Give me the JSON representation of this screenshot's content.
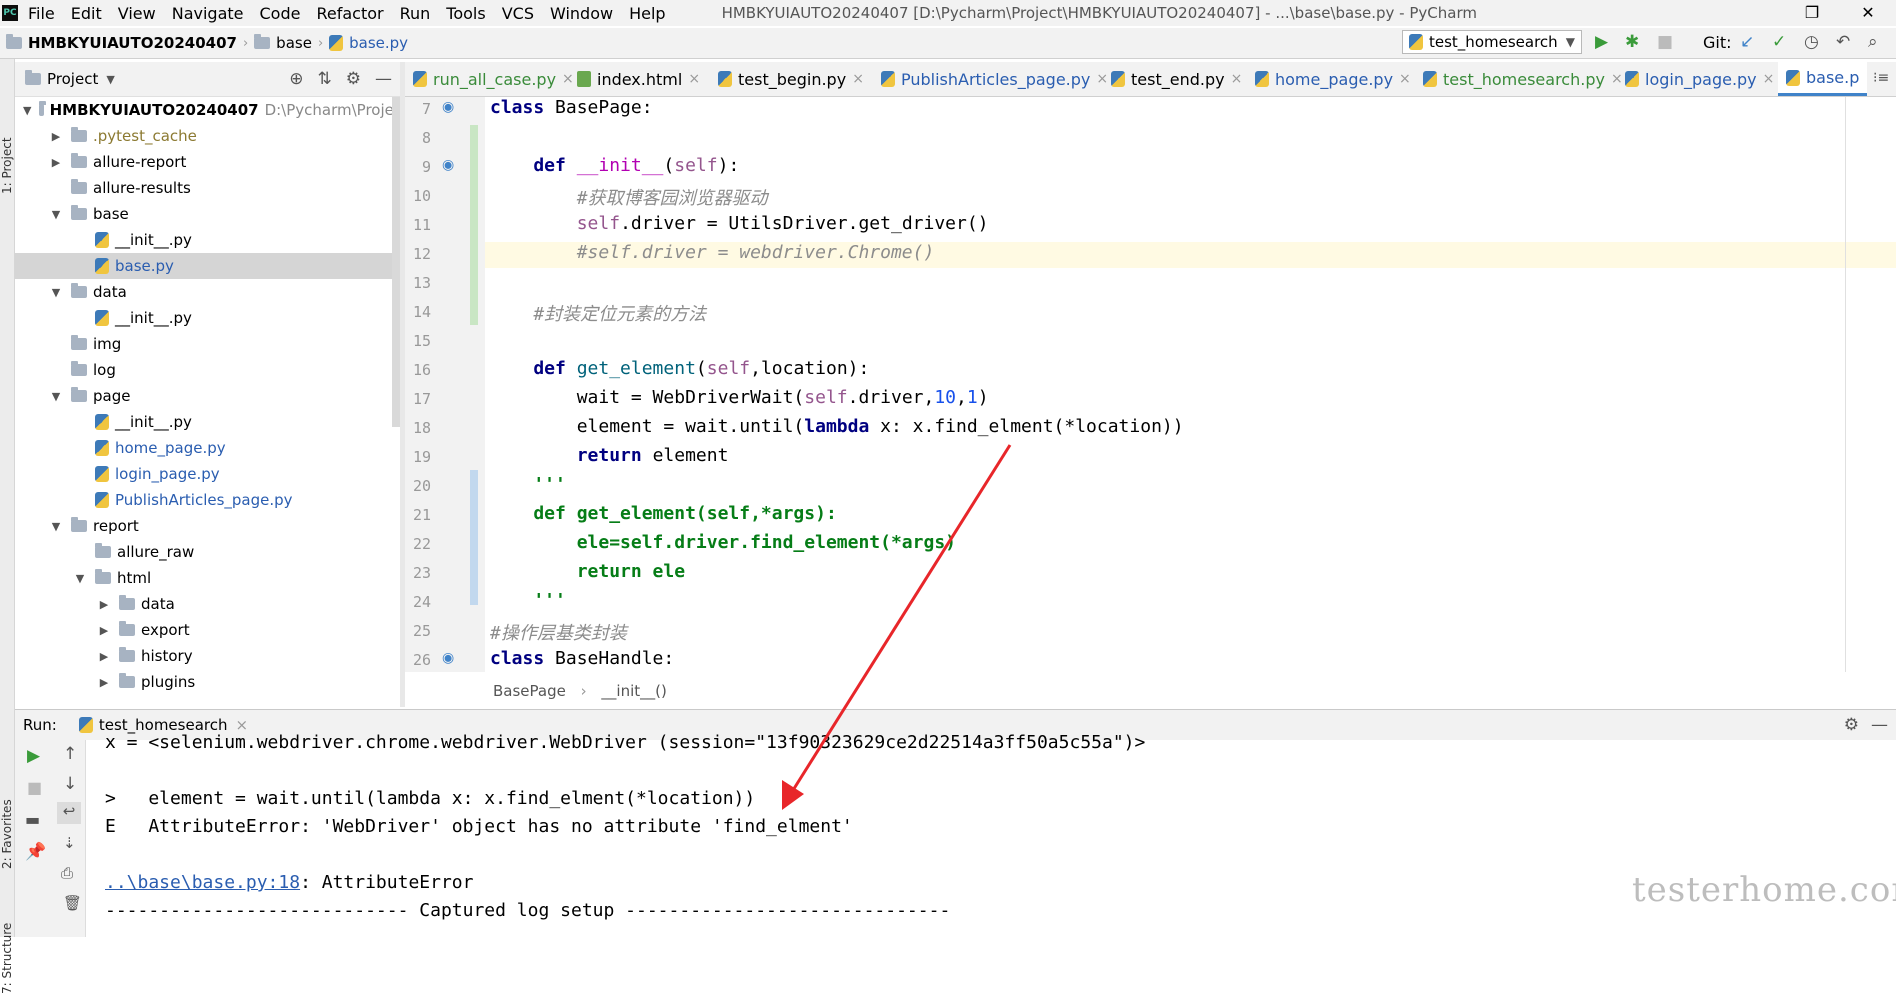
{
  "menu": [
    "File",
    "Edit",
    "View",
    "Navigate",
    "Code",
    "Refactor",
    "Run",
    "Tools",
    "VCS",
    "Window",
    "Help"
  ],
  "window_title": "HMBKYUIAUTO20240407 [D:\\Pycharm\\Project\\HMBKYUIAUTO20240407] - ...\\base\\base.py - PyCharm",
  "breadcrumb": [
    "HMBKYUIAUTO20240407",
    "base",
    "base.py"
  ],
  "run_config": "test_homesearch",
  "git_label": "Git:",
  "left_strip": {
    "project": "1: Project",
    "favorites": "2: Favorites",
    "structure": "7: Structure"
  },
  "project_panel": {
    "title": "Project",
    "root_name": "HMBKYUIAUTO20240407",
    "root_path": "D:\\Pycharm\\Project",
    "items": [
      {
        "label": ".pytest_cache"
      },
      {
        "label": "allure-report"
      },
      {
        "label": "allure-results"
      },
      {
        "label": "base"
      },
      {
        "label": "__init__.py"
      },
      {
        "label": "base.py"
      },
      {
        "label": "data"
      },
      {
        "label": "__init__.py"
      },
      {
        "label": "img"
      },
      {
        "label": "log"
      },
      {
        "label": "page"
      },
      {
        "label": "__init__.py"
      },
      {
        "label": "home_page.py"
      },
      {
        "label": "login_page.py"
      },
      {
        "label": "PublishArticles_page.py"
      },
      {
        "label": "report"
      },
      {
        "label": "allure_raw"
      },
      {
        "label": "html"
      },
      {
        "label": "data"
      },
      {
        "label": "export"
      },
      {
        "label": "history"
      },
      {
        "label": "plugins"
      }
    ]
  },
  "tabs": [
    "run_all_case.py",
    "index.html",
    "test_begin.py",
    "PublishArticles_page.py",
    "test_end.py",
    "home_page.py",
    "test_homesearch.py",
    "login_page.py",
    "base.p"
  ],
  "line_numbers": [
    "7",
    "8",
    "9",
    "10",
    "11",
    "12",
    "13",
    "14",
    "15",
    "16",
    "17",
    "18",
    "19",
    "20",
    "21",
    "22",
    "23",
    "24",
    "25",
    "26"
  ],
  "code": {
    "l7a": "class",
    "l7b": " BasePage:",
    "l9a": "    def ",
    "l9b": "__init__",
    "l9c": "(",
    "l9d": "self",
    "l9e": "):",
    "l10": "        #获取博客园浏览器驱动",
    "l11a": "        ",
    "l11b": "self",
    "l11c": ".driver = UtilsDriver.get_driver()",
    "l12": "        #self.driver = webdriver.Chrome()",
    "l14": "    #封装定位元素的方法",
    "l16a": "    def ",
    "l16b": "get_element",
    "l16c": "(",
    "l16d": "self",
    "l16e": ",location):",
    "l17a": "        wait = WebDriverWait(",
    "l17b": "self",
    "l17c": ".driver,",
    "l17d": "10",
    "l17e": ",",
    "l17f": "1",
    "l17g": ")",
    "l18a": "        element = wait.until(",
    "l18b": "lambda",
    "l18c": " x: x.find_elment(*location))",
    "l19a": "        ",
    "l19b": "return",
    "l19c": " element",
    "l20": "    '''",
    "l21": "    def get_element(self,*args):",
    "l22": "        ele=self.driver.find_element(*args)",
    "l23": "        return ele",
    "l24": "    '''",
    "l25": "#操作层基类封装",
    "l26a": "class",
    "l26b": " BaseHandle:"
  },
  "editor_breadcrumb": [
    "BasePage",
    "__init__()"
  ],
  "run_panel": {
    "label": "Run:",
    "tab": "test_homesearch",
    "lines": {
      "o1": "x = <selenium.webdriver.chrome.webdriver.WebDriver (session=\"13f90323629ce2d22514a3ff50a5c55a\")>",
      "o2": ">   element = wait.until(lambda x: x.find_elment(*location))",
      "o3": "E   AttributeError: 'WebDriver' object has no attribute 'find_elment'",
      "o4link": "..\\base\\base.py:18",
      "o4rest": ": AttributeError",
      "o5": "---------------------------- Captured log setup ------------------------------"
    }
  },
  "watermark": "testerhome.com",
  "colors": {
    "accent": "#4083c9",
    "arrow": "#e8262a",
    "current_line": "#fffae3"
  }
}
